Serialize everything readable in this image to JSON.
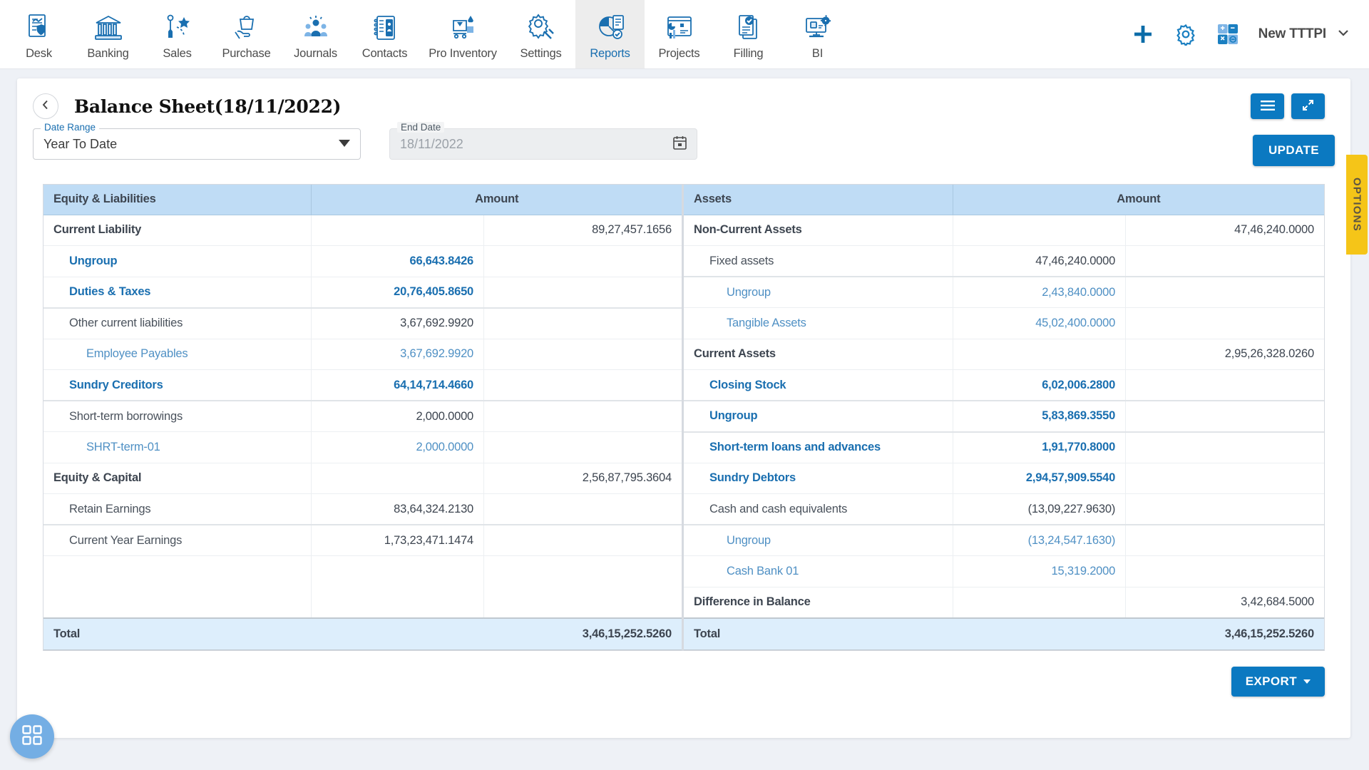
{
  "nav": {
    "items": [
      {
        "label": "Desk",
        "icon": "desk-chart-shield-icon",
        "active": false
      },
      {
        "label": "Banking",
        "icon": "bank-building-icon",
        "active": false
      },
      {
        "label": "Sales",
        "icon": "sales-megaphone-icon",
        "active": false
      },
      {
        "label": "Purchase",
        "icon": "purchase-bag-hand-icon",
        "active": false
      },
      {
        "label": "Journals",
        "icon": "journals-people-icon",
        "active": false
      },
      {
        "label": "Contacts",
        "icon": "contacts-card-icon",
        "active": false
      },
      {
        "label": "Pro Inventory",
        "icon": "inventory-cart-icon",
        "active": false
      },
      {
        "label": "Settings",
        "icon": "settings-tools-icon",
        "active": false
      },
      {
        "label": "Reports",
        "icon": "reports-piechart-icon",
        "active": true
      },
      {
        "label": "Projects",
        "icon": "projects-dashboard-icon",
        "active": false
      },
      {
        "label": "Filling",
        "icon": "filling-documents-icon",
        "active": false
      },
      {
        "label": "BI",
        "icon": "bi-monitor-gear-icon",
        "active": false
      }
    ],
    "actions": {
      "add_icon": "plus-icon",
      "settings_icon": "gear-icon",
      "calculator_icon": "calculator-icon"
    },
    "company": {
      "name": "New TTTPI",
      "chevron_icon": "chevron-down-icon"
    }
  },
  "page": {
    "back_icon": "chevron-left-icon",
    "title": "Balance Sheet(18/11/2022)",
    "list_view_icon": "hamburger-list-icon",
    "expand_icon": "expand-arrows-icon",
    "options_tab_label": "OPTIONS"
  },
  "filters": {
    "date_range": {
      "label": "Date Range",
      "value": "Year To Date",
      "chevron_icon": "chevron-down-icon"
    },
    "end_date": {
      "label": "End Date",
      "value": "18/11/2022",
      "calendar_icon": "calendar-icon"
    },
    "update_label": "UPDATE"
  },
  "table": {
    "left": {
      "header_name": "Equity & Liabilities",
      "header_amount": "Amount",
      "rows": [
        {
          "name": "Current Liability",
          "level": 0,
          "style": "bold",
          "a1": "",
          "a2": "89,27,457.1656",
          "a1_style": "plain",
          "a2_style": "plain"
        },
        {
          "name": "Ungroup",
          "level": 1,
          "style": "linkb",
          "a1": "66,643.8426",
          "a2": "",
          "a1_style": "linkb",
          "a2_style": "plain"
        },
        {
          "name": "Duties & Taxes",
          "level": 1,
          "style": "linkb",
          "a1": "20,76,405.8650",
          "a2": "",
          "a1_style": "linkb",
          "a2_style": "plain",
          "thick": true
        },
        {
          "name": "Other current liabilities",
          "level": 1,
          "style": "plain",
          "a1": "3,67,692.9920",
          "a2": "",
          "a1_style": "plain",
          "a2_style": "plain"
        },
        {
          "name": "Employee Payables",
          "level": 2,
          "style": "linkl",
          "a1": "3,67,692.9920",
          "a2": "",
          "a1_style": "linkl",
          "a2_style": "plain"
        },
        {
          "name": "Sundry Creditors",
          "level": 1,
          "style": "linkb",
          "a1": "64,14,714.4660",
          "a2": "",
          "a1_style": "linkb",
          "a2_style": "plain",
          "thick": true
        },
        {
          "name": "Short-term borrowings",
          "level": 1,
          "style": "plain",
          "a1": "2,000.0000",
          "a2": "",
          "a1_style": "plain",
          "a2_style": "plain"
        },
        {
          "name": "SHRT-term-01",
          "level": 2,
          "style": "linkl",
          "a1": "2,000.0000",
          "a2": "",
          "a1_style": "linkl",
          "a2_style": "plain"
        },
        {
          "name": "Equity & Capital",
          "level": 0,
          "style": "bold",
          "a1": "",
          "a2": "2,56,87,795.3604",
          "a1_style": "plain",
          "a2_style": "plain"
        },
        {
          "name": "Retain Earnings",
          "level": 1,
          "style": "plain",
          "a1": "83,64,324.2130",
          "a2": "",
          "a1_style": "plain",
          "a2_style": "plain",
          "thick": true
        },
        {
          "name": "Current Year Earnings",
          "level": 1,
          "style": "plain",
          "a1": "1,73,23,471.1474",
          "a2": "",
          "a1_style": "plain",
          "a2_style": "plain"
        }
      ],
      "blank_rows": 2,
      "total_label": "Total",
      "total_value": "3,46,15,252.5260"
    },
    "right": {
      "header_name": "Assets",
      "header_amount": "Amount",
      "rows": [
        {
          "name": "Non-Current Assets",
          "level": 0,
          "style": "bold",
          "a1": "",
          "a2": "47,46,240.0000",
          "a1_style": "plain",
          "a2_style": "plain"
        },
        {
          "name": "Fixed assets",
          "level": 1,
          "style": "plain",
          "a1": "47,46,240.0000",
          "a2": "",
          "a1_style": "plain",
          "a2_style": "plain",
          "thick": true
        },
        {
          "name": "Ungroup",
          "level": 2,
          "style": "linkl",
          "a1": "2,43,840.0000",
          "a2": "",
          "a1_style": "linkl",
          "a2_style": "plain"
        },
        {
          "name": "Tangible Assets",
          "level": 2,
          "style": "linkl",
          "a1": "45,02,400.0000",
          "a2": "",
          "a1_style": "linkl",
          "a2_style": "plain"
        },
        {
          "name": "Current Assets",
          "level": 0,
          "style": "bold",
          "a1": "",
          "a2": "2,95,26,328.0260",
          "a1_style": "plain",
          "a2_style": "plain"
        },
        {
          "name": "Closing Stock",
          "level": 1,
          "style": "linkb",
          "a1": "6,02,006.2800",
          "a2": "",
          "a1_style": "linkb",
          "a2_style": "plain",
          "thick": true
        },
        {
          "name": "Ungroup",
          "level": 1,
          "style": "linkb",
          "a1": "5,83,869.3550",
          "a2": "",
          "a1_style": "linkb",
          "a2_style": "plain",
          "thick": true
        },
        {
          "name": "Short-term loans and advances",
          "level": 1,
          "style": "linkb",
          "a1": "1,91,770.8000",
          "a2": "",
          "a1_style": "linkb",
          "a2_style": "plain"
        },
        {
          "name": "Sundry Debtors",
          "level": 1,
          "style": "linkb",
          "a1": "2,94,57,909.5540",
          "a2": "",
          "a1_style": "linkb",
          "a2_style": "plain"
        },
        {
          "name": "Cash and cash equivalents",
          "level": 1,
          "style": "plain",
          "a1": "(13,09,227.9630)",
          "a2": "",
          "a1_style": "plain",
          "a2_style": "plain",
          "thick": true
        },
        {
          "name": "Ungroup",
          "level": 2,
          "style": "linkl",
          "a1": "(13,24,547.1630)",
          "a2": "",
          "a1_style": "linkl",
          "a2_style": "plain"
        },
        {
          "name": "Cash Bank 01",
          "level": 2,
          "style": "linkl",
          "a1": "15,319.2000",
          "a2": "",
          "a1_style": "linkl",
          "a2_style": "plain"
        },
        {
          "name": "Difference in Balance",
          "level": 0,
          "style": "bold",
          "a1": "",
          "a2": "3,42,684.5000",
          "a1_style": "plain",
          "a2_style": "plain"
        }
      ],
      "blank_rows": 0,
      "total_label": "Total",
      "total_value": "3,46,15,252.5260"
    }
  },
  "footer": {
    "export_label": "EXPORT",
    "export_caret_icon": "caret-down-icon",
    "fab_icon": "grid-apps-icon"
  }
}
